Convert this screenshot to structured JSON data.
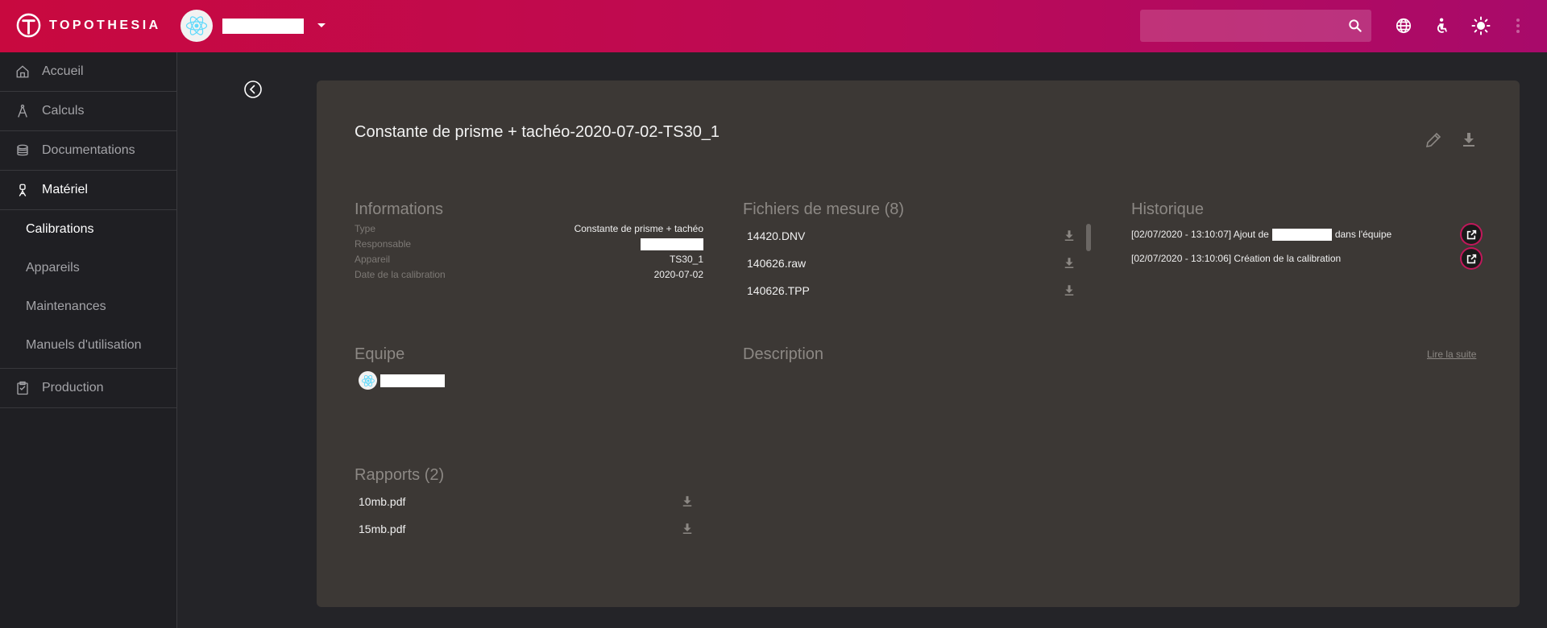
{
  "brand": {
    "name": "TOPOTHESIA"
  },
  "account": {
    "icon": "react-logo-icon"
  },
  "topbar": {
    "search": {
      "placeholder": "",
      "icon": "search-icon"
    },
    "icons": [
      "globe-icon",
      "accessibility-icon",
      "brightness-icon",
      "more-vertical-icon"
    ]
  },
  "sidebar": {
    "items": [
      {
        "label": "Accueil",
        "icon": "home-icon"
      },
      {
        "label": "Calculs",
        "icon": "compass-icon"
      },
      {
        "label": "Documentations",
        "icon": "layers-icon"
      },
      {
        "label": "Matériel",
        "icon": "total-station-icon"
      },
      {
        "label": "Production",
        "icon": "clipboard-icon"
      }
    ],
    "materiel_sub": [
      {
        "label": "Calibrations",
        "selected": true
      },
      {
        "label": "Appareils"
      },
      {
        "label": "Maintenances"
      },
      {
        "label": "Manuels d'utilisation"
      }
    ]
  },
  "card": {
    "title": "Constante de prisme + tachéo-2020-07-02-TS30_1",
    "informations": {
      "title": "Informations",
      "rows": [
        {
          "label": "Type",
          "value": "Constante de prisme + tachéo"
        },
        {
          "label": "Responsable",
          "value": ""
        },
        {
          "label": "Appareil",
          "value": "TS30_1"
        },
        {
          "label": "Date de la calibration",
          "value": "2020-07-02"
        }
      ]
    },
    "fichiers": {
      "title": "Fichiers de mesure (8)",
      "files": [
        "14420.DNV",
        "140626.raw",
        "140626.TPP"
      ]
    },
    "historique": {
      "title": "Historique",
      "entries": [
        {
          "prefix": "[02/07/2020 - 13:10:07] Ajout de",
          "suffix": "dans l'équipe"
        },
        {
          "prefix": "[02/07/2020 - 13:10:06] Création de la calibration",
          "suffix": ""
        }
      ]
    },
    "equipe": {
      "title": "Equipe"
    },
    "description": {
      "title": "Description",
      "read_more": "Lire la suite"
    },
    "rapports": {
      "title": "Rapports (2)",
      "files": [
        "10mb.pdf",
        "15mb.pdf"
      ]
    }
  },
  "colors": {
    "topbar_start": "#c8093f",
    "topbar_end": "#a80a6a",
    "card_bg": "#3c3835",
    "sidebar_bg": "#1f1f23",
    "accent": "#c2185b"
  }
}
